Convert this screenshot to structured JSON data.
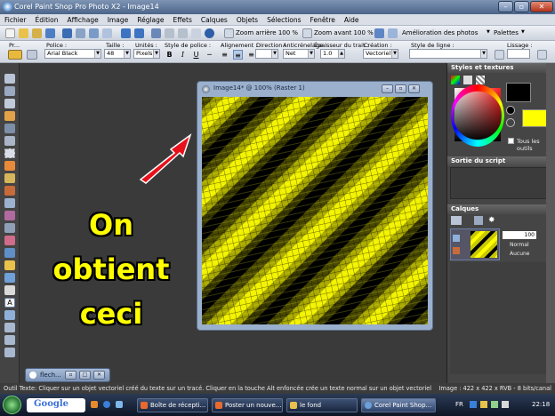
{
  "app": {
    "title": "Corel Paint Shop Pro Photo X2 - Image14"
  },
  "menu": {
    "items": [
      "Fichier",
      "Édition",
      "Affichage",
      "Image",
      "Réglage",
      "Effets",
      "Calques",
      "Objets",
      "Sélections",
      "Fenêtre",
      "Aide"
    ]
  },
  "toolbar": {
    "zoom_out_label": "Zoom arrière 100 %",
    "zoom_in_label": "Zoom avant 100 %",
    "improve_label": "Amélioration des photos",
    "palettes_label": "Palettes"
  },
  "text_options": {
    "presets_label": "Pr...",
    "font_label": "Police :",
    "font_value": "Arial Black",
    "size_label": "Taille :",
    "size_value": "48",
    "units_label": "Unités :",
    "units_value": "Pixels...",
    "style_label": "Style de police :",
    "align_label": "Alignement :",
    "direction_label": "Direction :",
    "antialias_label": "Anticrénelage :",
    "antialias_value": "Net",
    "stroke_label": "Épaisseur du trait :",
    "stroke_value": "1.0",
    "create_label": "Création :",
    "create_value": "Vectoriel",
    "line_style_label": "Style de ligne :",
    "smooth_label": "Lissage :",
    "bold": "B",
    "italic": "I",
    "underline": "U"
  },
  "annotation": {
    "line1": "On obtient",
    "line2": "ceci"
  },
  "image_window": {
    "title": "Image14* @ 100% (Raster 1)"
  },
  "minimized_window": {
    "title": "flech..."
  },
  "palettes": {
    "materials_title": "Styles et textures",
    "all_tools_label": "Tous les outils",
    "script_title": "Sortie du script",
    "layers_title": "Calques",
    "opacity_value": "100",
    "blend_mode": "Normal",
    "mask_label": "Aucune"
  },
  "status": {
    "left": "Outil Texte: Cliquer sur un objet vectoriel créé du texte sur un tracé. Cliquer en la touche Alt enfoncée crée un texte normal sur un objet vectoriel",
    "right": "Image : 422 x 422 x RVB - 8 bits/canal"
  },
  "taskbar": {
    "google_label": "Google",
    "tasks": [
      {
        "label": "Boîte de récepti..."
      },
      {
        "label": "Poster un nouve..."
      },
      {
        "label": "le fond"
      },
      {
        "label": "Corel Paint Shop..."
      }
    ],
    "lang": "FR",
    "clock": "22:18"
  },
  "colors": {
    "accent_yellow": "#ffff00",
    "annotation_arrow": "#e8101a",
    "foreground_swatch": "#000000",
    "background_swatch": "#ffff00"
  }
}
